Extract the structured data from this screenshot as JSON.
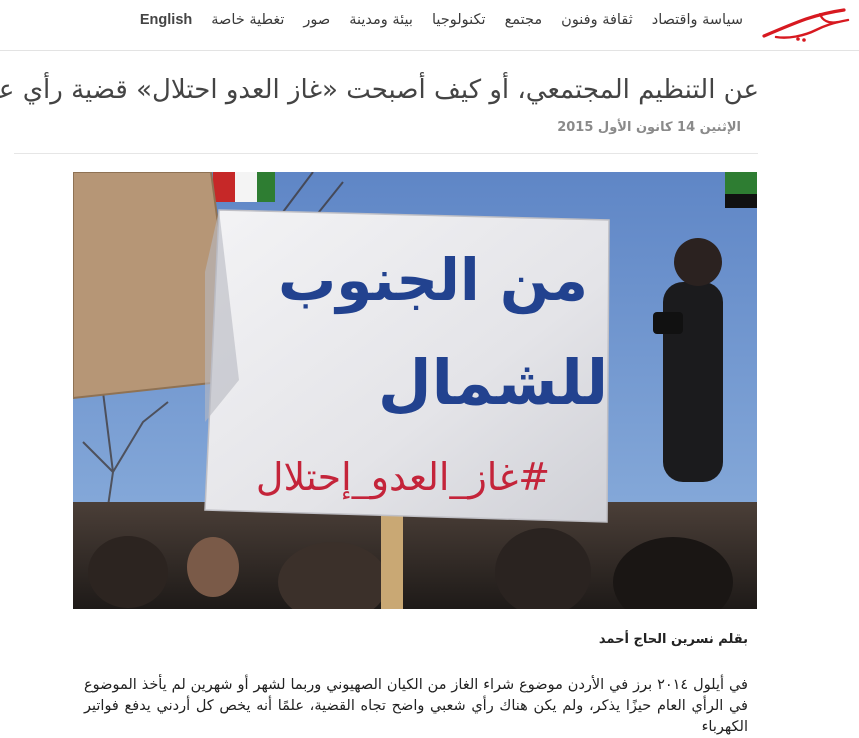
{
  "brand": {
    "logo_color": "#d71920"
  },
  "nav": {
    "items": [
      "سياسة واقتصاد",
      "ثقافة وفنون",
      "مجتمع",
      "تكنولوجيا",
      "بيئة ومدينة",
      "صور",
      "تغطية خاصة",
      "English"
    ]
  },
  "article": {
    "title": "عن التنظيم المجتمعي، أو كيف أصبحت «غاز العدو احتلال» قضية رأي عام",
    "date": "الإثنين 14 كانون الأول 2015",
    "sign_lines": [
      "من الجنوب",
      "للشمال",
      "#غاز_العدو_إحتلال"
    ],
    "byline": "بقلم نسرين الحاج أحمد",
    "paragraph": "في أيلول ٢٠١٤ برز في الأردن موضوع شراء الغاز من الكيان الصهيوني وربما لشهر أو شهرين لم يأخذ الموضوع في الرأي العام حيزًا يذكر، ولم يكن هناك رأي شعبي واضح تجاه القضية، علمًا أنه يخص كل أردني يدفع فواتير الكهرباء"
  }
}
